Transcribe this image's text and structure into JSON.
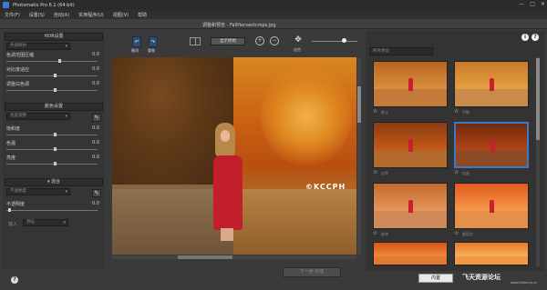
{
  "window": {
    "title": "Photomatix Pro 6.1 (64-bit)",
    "controls": [
      "—",
      "□",
      "✕"
    ]
  },
  "menu": [
    "文件(F)",
    "设置(S)",
    "自动(A)",
    "实用程序(U)",
    "视图(V)",
    "帮助"
  ],
  "document": {
    "title": "调整和预览 - FallHarvestcrops.jpg"
  },
  "left_panel": {
    "section1": {
      "title": "HDR设置",
      "dropdown": "色调映射",
      "sliders": [
        {
          "label": "色调范围压缩",
          "value": "0.0",
          "level": 0.55
        },
        {
          "label": "对比度适应",
          "value": "0.0",
          "level": 0.5
        },
        {
          "label": "调整白色调",
          "value": "0.0",
          "level": 0.5
        }
      ]
    },
    "section2": {
      "title": "颜色设置",
      "dropdown": "温度调整",
      "sliders": [
        {
          "label": "饱和度",
          "value": "0.0",
          "level": 0.5
        },
        {
          "label": "色温",
          "value": "0.0",
          "level": 0.5
        },
        {
          "label": "亮度",
          "value": "0.0",
          "level": 0.5
        }
      ]
    },
    "section3": {
      "title": "▾ 混合",
      "dropdown": "不透明度",
      "sliders": [
        {
          "label": "不透明度",
          "value": "0.0",
          "level": 0.02
        }
      ],
      "bottom_dropdown": "预设",
      "bottom_label": "输入"
    }
  },
  "toolbar": {
    "undo": "撤消",
    "redo": "重做",
    "show_original": "显示原始",
    "fit_label": "适合",
    "zoom_in": "+",
    "zoom_out": "−",
    "zoom_level": 0.7
  },
  "image": {
    "watermark": "©KCCPH"
  },
  "actions": {
    "next": "下一步 完成"
  },
  "right_panel": {
    "preset_dropdown": "所有预设",
    "info": "i",
    "help": "?",
    "thumb_labels": [
      "默认",
      "平衡",
      "自然",
      "绘画",
      "鲜艳",
      "超现实"
    ],
    "built_in": "内置"
  },
  "site": {
    "name": "飞天资源论坛",
    "url": "www.feitianzy.cn"
  },
  "colors": {
    "selection": "#3c79c9",
    "dress": "#c21f2a"
  }
}
